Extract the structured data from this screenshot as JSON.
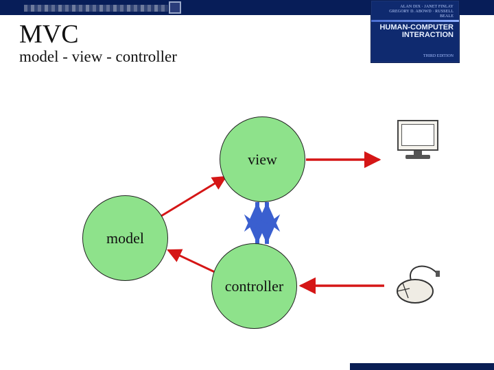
{
  "banner": {
    "authors_line1": "ALAN DIX · JANET FINLAY",
    "authors_line2": "GREGORY D. ABOWD · RUSSELL BEALE",
    "title_line1": "HUMAN-COMPUTER",
    "title_line2": "INTERACTION",
    "edition": "THIRD EDITION"
  },
  "heading": {
    "title": "MVC",
    "subtitle": "model - view  - controller"
  },
  "nodes": {
    "model": "model",
    "view": "view",
    "controller": "controller"
  },
  "chart_data": {
    "type": "diagram",
    "title": "MVC model - view - controller",
    "nodes": [
      {
        "id": "model",
        "label": "model"
      },
      {
        "id": "view",
        "label": "view"
      },
      {
        "id": "controller",
        "label": "controller"
      },
      {
        "id": "display",
        "label": "monitor (output device)"
      },
      {
        "id": "mouse",
        "label": "mouse (input device)"
      }
    ],
    "edges": [
      {
        "from": "model",
        "to": "view",
        "color": "red",
        "style": "solid",
        "directed": true
      },
      {
        "from": "view",
        "to": "controller",
        "color": "blue",
        "style": "solid",
        "directed": "both"
      },
      {
        "from": "controller",
        "to": "model",
        "color": "red",
        "style": "solid",
        "directed": true
      },
      {
        "from": "view",
        "to": "display",
        "color": "red",
        "style": "solid",
        "directed": true
      },
      {
        "from": "mouse",
        "to": "controller",
        "color": "red",
        "style": "solid",
        "directed": true
      }
    ]
  }
}
